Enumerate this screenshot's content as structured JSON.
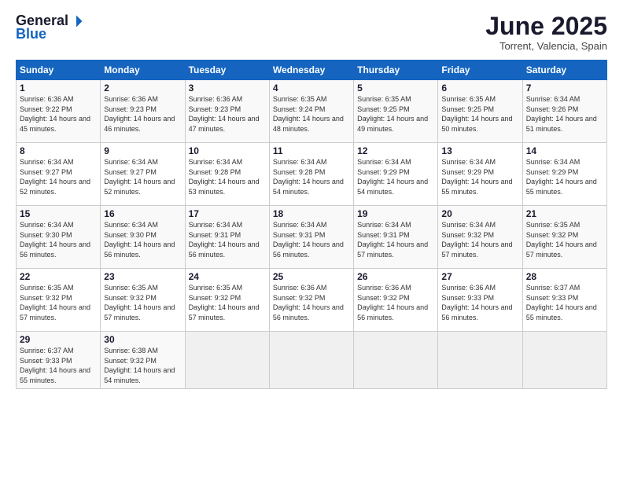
{
  "logo": {
    "general": "General",
    "blue": "Blue"
  },
  "title": "June 2025",
  "location": "Torrent, Valencia, Spain",
  "days_header": [
    "Sunday",
    "Monday",
    "Tuesday",
    "Wednesday",
    "Thursday",
    "Friday",
    "Saturday"
  ],
  "weeks": [
    [
      {
        "num": "1",
        "sunrise": "6:36 AM",
        "sunset": "9:22 PM",
        "daylight": "14 hours and 45 minutes."
      },
      {
        "num": "2",
        "sunrise": "6:36 AM",
        "sunset": "9:23 PM",
        "daylight": "14 hours and 46 minutes."
      },
      {
        "num": "3",
        "sunrise": "6:36 AM",
        "sunset": "9:23 PM",
        "daylight": "14 hours and 47 minutes."
      },
      {
        "num": "4",
        "sunrise": "6:35 AM",
        "sunset": "9:24 PM",
        "daylight": "14 hours and 48 minutes."
      },
      {
        "num": "5",
        "sunrise": "6:35 AM",
        "sunset": "9:25 PM",
        "daylight": "14 hours and 49 minutes."
      },
      {
        "num": "6",
        "sunrise": "6:35 AM",
        "sunset": "9:25 PM",
        "daylight": "14 hours and 50 minutes."
      },
      {
        "num": "7",
        "sunrise": "6:34 AM",
        "sunset": "9:26 PM",
        "daylight": "14 hours and 51 minutes."
      }
    ],
    [
      {
        "num": "8",
        "sunrise": "6:34 AM",
        "sunset": "9:27 PM",
        "daylight": "14 hours and 52 minutes."
      },
      {
        "num": "9",
        "sunrise": "6:34 AM",
        "sunset": "9:27 PM",
        "daylight": "14 hours and 52 minutes."
      },
      {
        "num": "10",
        "sunrise": "6:34 AM",
        "sunset": "9:28 PM",
        "daylight": "14 hours and 53 minutes."
      },
      {
        "num": "11",
        "sunrise": "6:34 AM",
        "sunset": "9:28 PM",
        "daylight": "14 hours and 54 minutes."
      },
      {
        "num": "12",
        "sunrise": "6:34 AM",
        "sunset": "9:29 PM",
        "daylight": "14 hours and 54 minutes."
      },
      {
        "num": "13",
        "sunrise": "6:34 AM",
        "sunset": "9:29 PM",
        "daylight": "14 hours and 55 minutes."
      },
      {
        "num": "14",
        "sunrise": "6:34 AM",
        "sunset": "9:29 PM",
        "daylight": "14 hours and 55 minutes."
      }
    ],
    [
      {
        "num": "15",
        "sunrise": "6:34 AM",
        "sunset": "9:30 PM",
        "daylight": "14 hours and 56 minutes."
      },
      {
        "num": "16",
        "sunrise": "6:34 AM",
        "sunset": "9:30 PM",
        "daylight": "14 hours and 56 minutes."
      },
      {
        "num": "17",
        "sunrise": "6:34 AM",
        "sunset": "9:31 PM",
        "daylight": "14 hours and 56 minutes."
      },
      {
        "num": "18",
        "sunrise": "6:34 AM",
        "sunset": "9:31 PM",
        "daylight": "14 hours and 56 minutes."
      },
      {
        "num": "19",
        "sunrise": "6:34 AM",
        "sunset": "9:31 PM",
        "daylight": "14 hours and 57 minutes."
      },
      {
        "num": "20",
        "sunrise": "6:34 AM",
        "sunset": "9:32 PM",
        "daylight": "14 hours and 57 minutes."
      },
      {
        "num": "21",
        "sunrise": "6:35 AM",
        "sunset": "9:32 PM",
        "daylight": "14 hours and 57 minutes."
      }
    ],
    [
      {
        "num": "22",
        "sunrise": "6:35 AM",
        "sunset": "9:32 PM",
        "daylight": "14 hours and 57 minutes."
      },
      {
        "num": "23",
        "sunrise": "6:35 AM",
        "sunset": "9:32 PM",
        "daylight": "14 hours and 57 minutes."
      },
      {
        "num": "24",
        "sunrise": "6:35 AM",
        "sunset": "9:32 PM",
        "daylight": "14 hours and 57 minutes."
      },
      {
        "num": "25",
        "sunrise": "6:36 AM",
        "sunset": "9:32 PM",
        "daylight": "14 hours and 56 minutes."
      },
      {
        "num": "26",
        "sunrise": "6:36 AM",
        "sunset": "9:32 PM",
        "daylight": "14 hours and 56 minutes."
      },
      {
        "num": "27",
        "sunrise": "6:36 AM",
        "sunset": "9:33 PM",
        "daylight": "14 hours and 56 minutes."
      },
      {
        "num": "28",
        "sunrise": "6:37 AM",
        "sunset": "9:33 PM",
        "daylight": "14 hours and 55 minutes."
      }
    ],
    [
      {
        "num": "29",
        "sunrise": "6:37 AM",
        "sunset": "9:33 PM",
        "daylight": "14 hours and 55 minutes."
      },
      {
        "num": "30",
        "sunrise": "6:38 AM",
        "sunset": "9:32 PM",
        "daylight": "14 hours and 54 minutes."
      },
      null,
      null,
      null,
      null,
      null
    ]
  ]
}
